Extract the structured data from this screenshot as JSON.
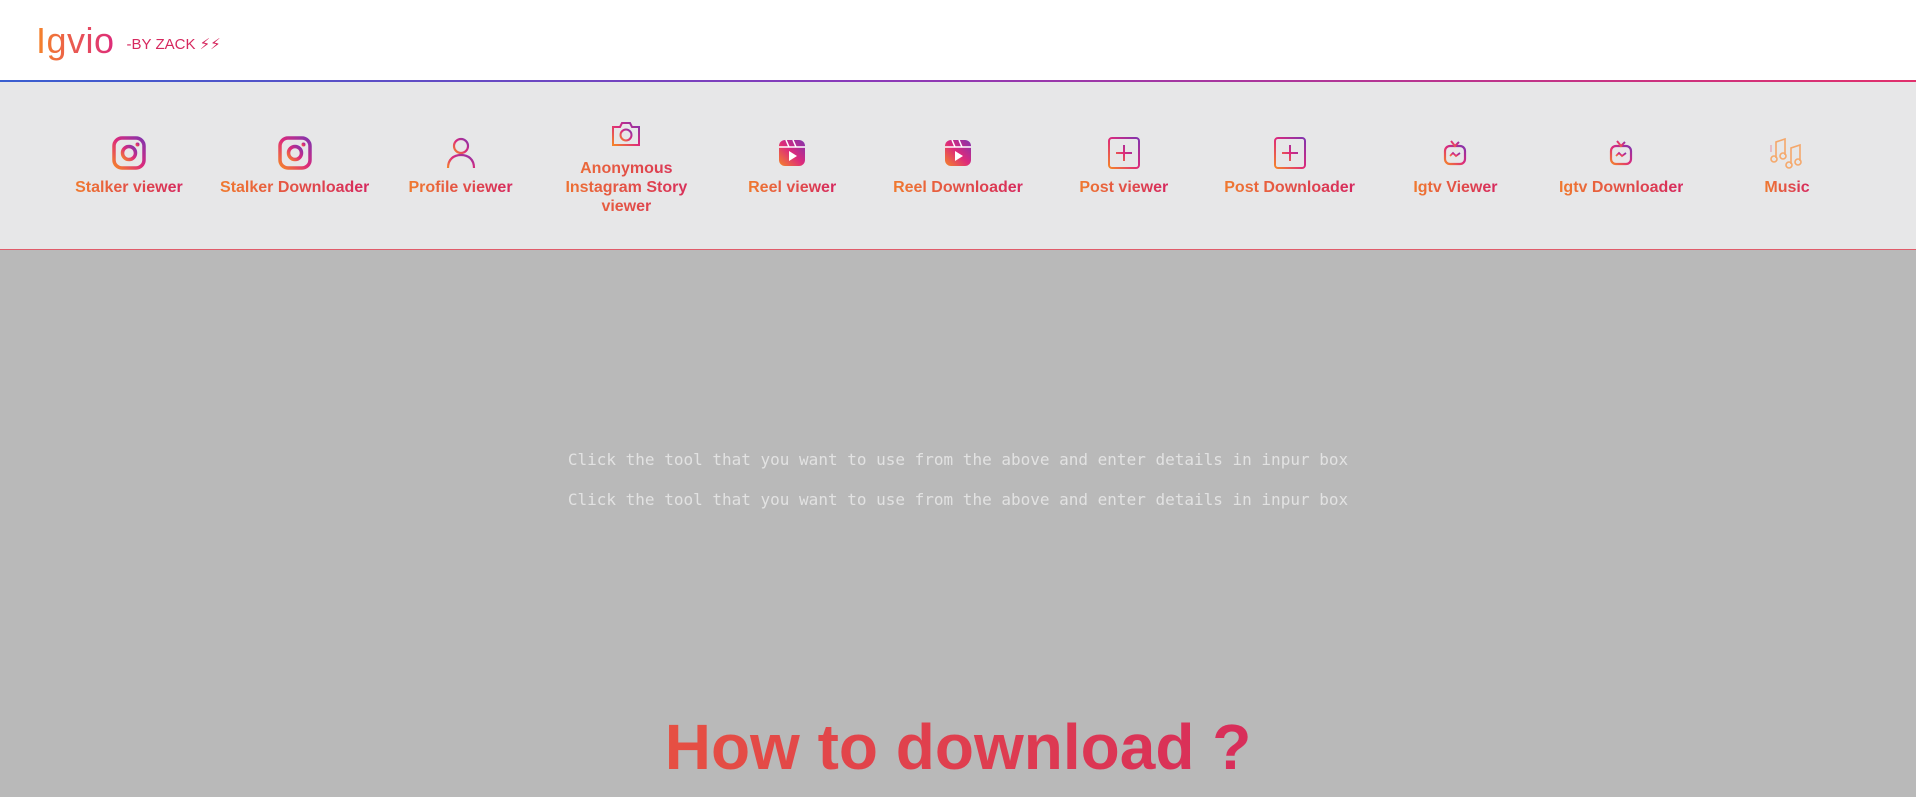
{
  "header": {
    "logo": "Igvio",
    "byline": "-BY ZACK ⚡⚡"
  },
  "tools": [
    {
      "label": "Stalker viewer",
      "icon": "instagram-icon"
    },
    {
      "label": "Stalker Downloader",
      "icon": "instagram-icon"
    },
    {
      "label": "Profile viewer",
      "icon": "user-icon"
    },
    {
      "label": "Anonymous Instagram Story viewer",
      "icon": "camera-icon"
    },
    {
      "label": "Reel viewer",
      "icon": "reel-icon"
    },
    {
      "label": "Reel Downloader",
      "icon": "reel-icon"
    },
    {
      "label": "Post viewer",
      "icon": "plus-square-icon"
    },
    {
      "label": "Post Downloader",
      "icon": "plus-square-icon"
    },
    {
      "label": "Igtv Viewer",
      "icon": "igtv-icon"
    },
    {
      "label": "Igtv Downloader",
      "icon": "igtv-icon"
    },
    {
      "label": "Music",
      "icon": "music-icon"
    }
  ],
  "main": {
    "hint1": "Click the tool that you want to use from the above and enter details in inpur box",
    "hint2": "Click the tool that you want to use from the above and enter details in inpur box",
    "howto_title": "How to download ?"
  },
  "colors": {
    "accent_start": "#f58529",
    "accent_end": "#dd2a7b",
    "toolbar_bg": "#e7e7e8",
    "main_bg": "#b9b9b9"
  }
}
